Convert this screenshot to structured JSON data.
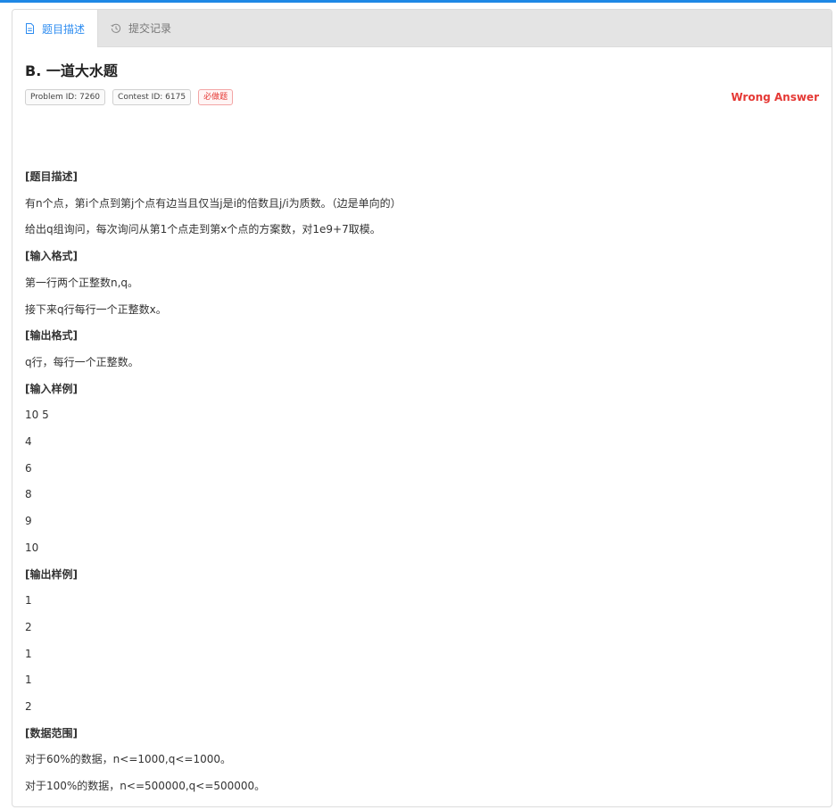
{
  "tabs": [
    {
      "label": "题目描述",
      "icon": "document-icon",
      "active": true
    },
    {
      "label": "提交记录",
      "icon": "history-icon",
      "active": false
    }
  ],
  "problem": {
    "title": "B.  一道大水题",
    "tags": {
      "problem_id": "Problem ID: 7260",
      "contest_id": "Contest ID: 6175",
      "must": "必做题"
    },
    "status": "Wrong Answer"
  },
  "statement": {
    "desc_h": "[题目描述]",
    "desc_1": "有n个点，第i个点到第j个点有边当且仅当j是i的倍数且j/i为质数。（边是单向的）",
    "desc_2": "给出q组询问，每次询问从第1个点走到第x个点的方案数，对1e9+7取模。",
    "input_h": "[输入格式]",
    "input_1": "第一行两个正整数n,q。",
    "input_2": "接下来q行每行一个正整数x。",
    "output_h": "[输出格式]",
    "output_1": "q行，每行一个正整数。",
    "sample_in_h": "[输入样例]",
    "sample_in": [
      "10 5",
      "4",
      "6",
      "8",
      "9",
      "10"
    ],
    "sample_out_h": "[输出样例]",
    "sample_out": [
      "1",
      "2",
      "1",
      "1",
      "2"
    ],
    "range_h": "[数据范围]",
    "range_1": "对于60%的数据，n<=1000,q<=1000。",
    "range_2": "对于100%的数据，n<=500000,q<=500000。"
  },
  "colors": {
    "accent": "#2d8cf0",
    "error": "#e53935"
  }
}
